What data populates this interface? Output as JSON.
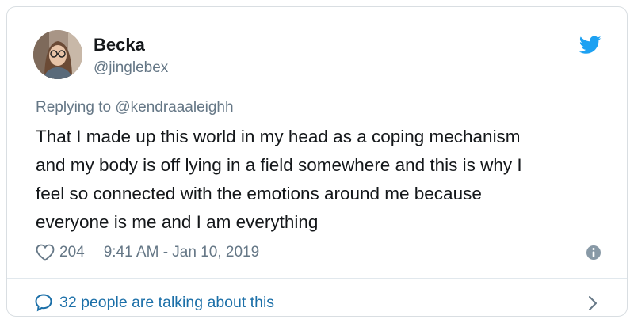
{
  "tweet": {
    "author_name": "Becka",
    "author_handle": "@jinglebex",
    "replying_label": "Replying to ",
    "replying_to": "@kendraaaleighh",
    "text": "That I made up this world in my head as a coping mechanism\nand my body is off lying in a field somewhere and this is why I\nfeel so connected with the emotions around me because\neveryone is me and I am everything",
    "likes": "204",
    "timestamp": "9:41 AM - Jan 10, 2019",
    "talking": "32 people are talking about this"
  },
  "icons": {
    "bird": "twitter-bird-icon",
    "heart": "heart-icon",
    "info": "info-icon",
    "bubble": "comment-bubble-icon",
    "chevron": "chevron-right-icon"
  },
  "colors": {
    "brand": "#1da1f2",
    "link": "#1b6fa8",
    "secondary_text": "#657786",
    "border": "#d9dee2"
  }
}
